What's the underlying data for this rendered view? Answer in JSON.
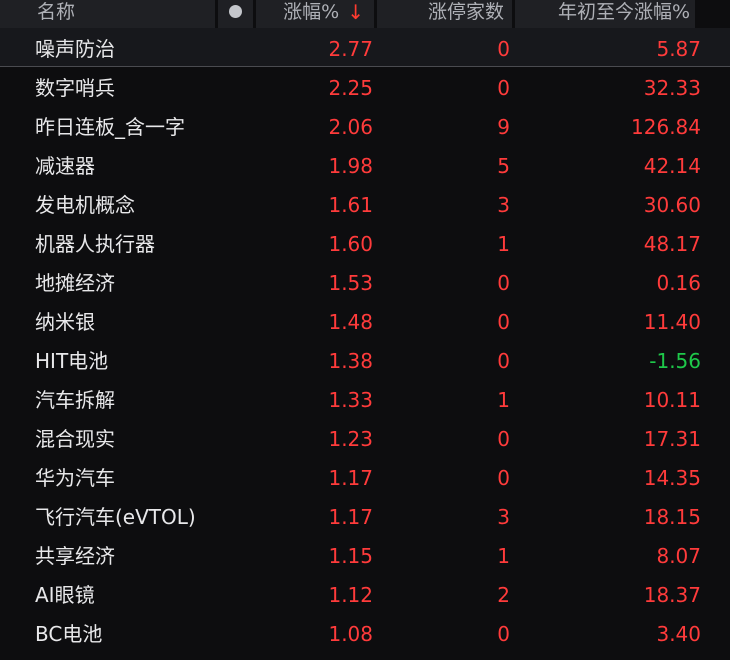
{
  "header": {
    "name": "名称",
    "change_pct": "涨幅%",
    "sort_icon": "↓",
    "limit_up_count": "涨停家数",
    "ytd_change": "年初至今涨幅%"
  },
  "colors": {
    "up": "#ff3b3b",
    "down": "#1ec84a",
    "background": "#0d0d0f",
    "header_bg": "#1f2024"
  },
  "rows": [
    {
      "name": "噪声防治",
      "change_pct": "2.77",
      "limit_up_count": "0",
      "ytd_change": "5.87",
      "ytd_trend": "up"
    },
    {
      "name": "数字哨兵",
      "change_pct": "2.25",
      "limit_up_count": "0",
      "ytd_change": "32.33",
      "ytd_trend": "up"
    },
    {
      "name": "昨日连板_含一字",
      "change_pct": "2.06",
      "limit_up_count": "9",
      "ytd_change": "126.84",
      "ytd_trend": "up"
    },
    {
      "name": "减速器",
      "change_pct": "1.98",
      "limit_up_count": "5",
      "ytd_change": "42.14",
      "ytd_trend": "up"
    },
    {
      "name": "发电机概念",
      "change_pct": "1.61",
      "limit_up_count": "3",
      "ytd_change": "30.60",
      "ytd_trend": "up"
    },
    {
      "name": "机器人执行器",
      "change_pct": "1.60",
      "limit_up_count": "1",
      "ytd_change": "48.17",
      "ytd_trend": "up"
    },
    {
      "name": "地摊经济",
      "change_pct": "1.53",
      "limit_up_count": "0",
      "ytd_change": "0.16",
      "ytd_trend": "up"
    },
    {
      "name": "纳米银",
      "change_pct": "1.48",
      "limit_up_count": "0",
      "ytd_change": "11.40",
      "ytd_trend": "up"
    },
    {
      "name": "HIT电池",
      "change_pct": "1.38",
      "limit_up_count": "0",
      "ytd_change": "-1.56",
      "ytd_trend": "down"
    },
    {
      "name": "汽车拆解",
      "change_pct": "1.33",
      "limit_up_count": "1",
      "ytd_change": "10.11",
      "ytd_trend": "up"
    },
    {
      "name": "混合现实",
      "change_pct": "1.23",
      "limit_up_count": "0",
      "ytd_change": "17.31",
      "ytd_trend": "up"
    },
    {
      "name": "华为汽车",
      "change_pct": "1.17",
      "limit_up_count": "0",
      "ytd_change": "14.35",
      "ytd_trend": "up"
    },
    {
      "name": "飞行汽车(eVTOL)",
      "change_pct": "1.17",
      "limit_up_count": "3",
      "ytd_change": "18.15",
      "ytd_trend": "up"
    },
    {
      "name": "共享经济",
      "change_pct": "1.15",
      "limit_up_count": "1",
      "ytd_change": "8.07",
      "ytd_trend": "up"
    },
    {
      "name": "AI眼镜",
      "change_pct": "1.12",
      "limit_up_count": "2",
      "ytd_change": "18.37",
      "ytd_trend": "up"
    },
    {
      "name": "BC电池",
      "change_pct": "1.08",
      "limit_up_count": "0",
      "ytd_change": "3.40",
      "ytd_trend": "up"
    }
  ]
}
